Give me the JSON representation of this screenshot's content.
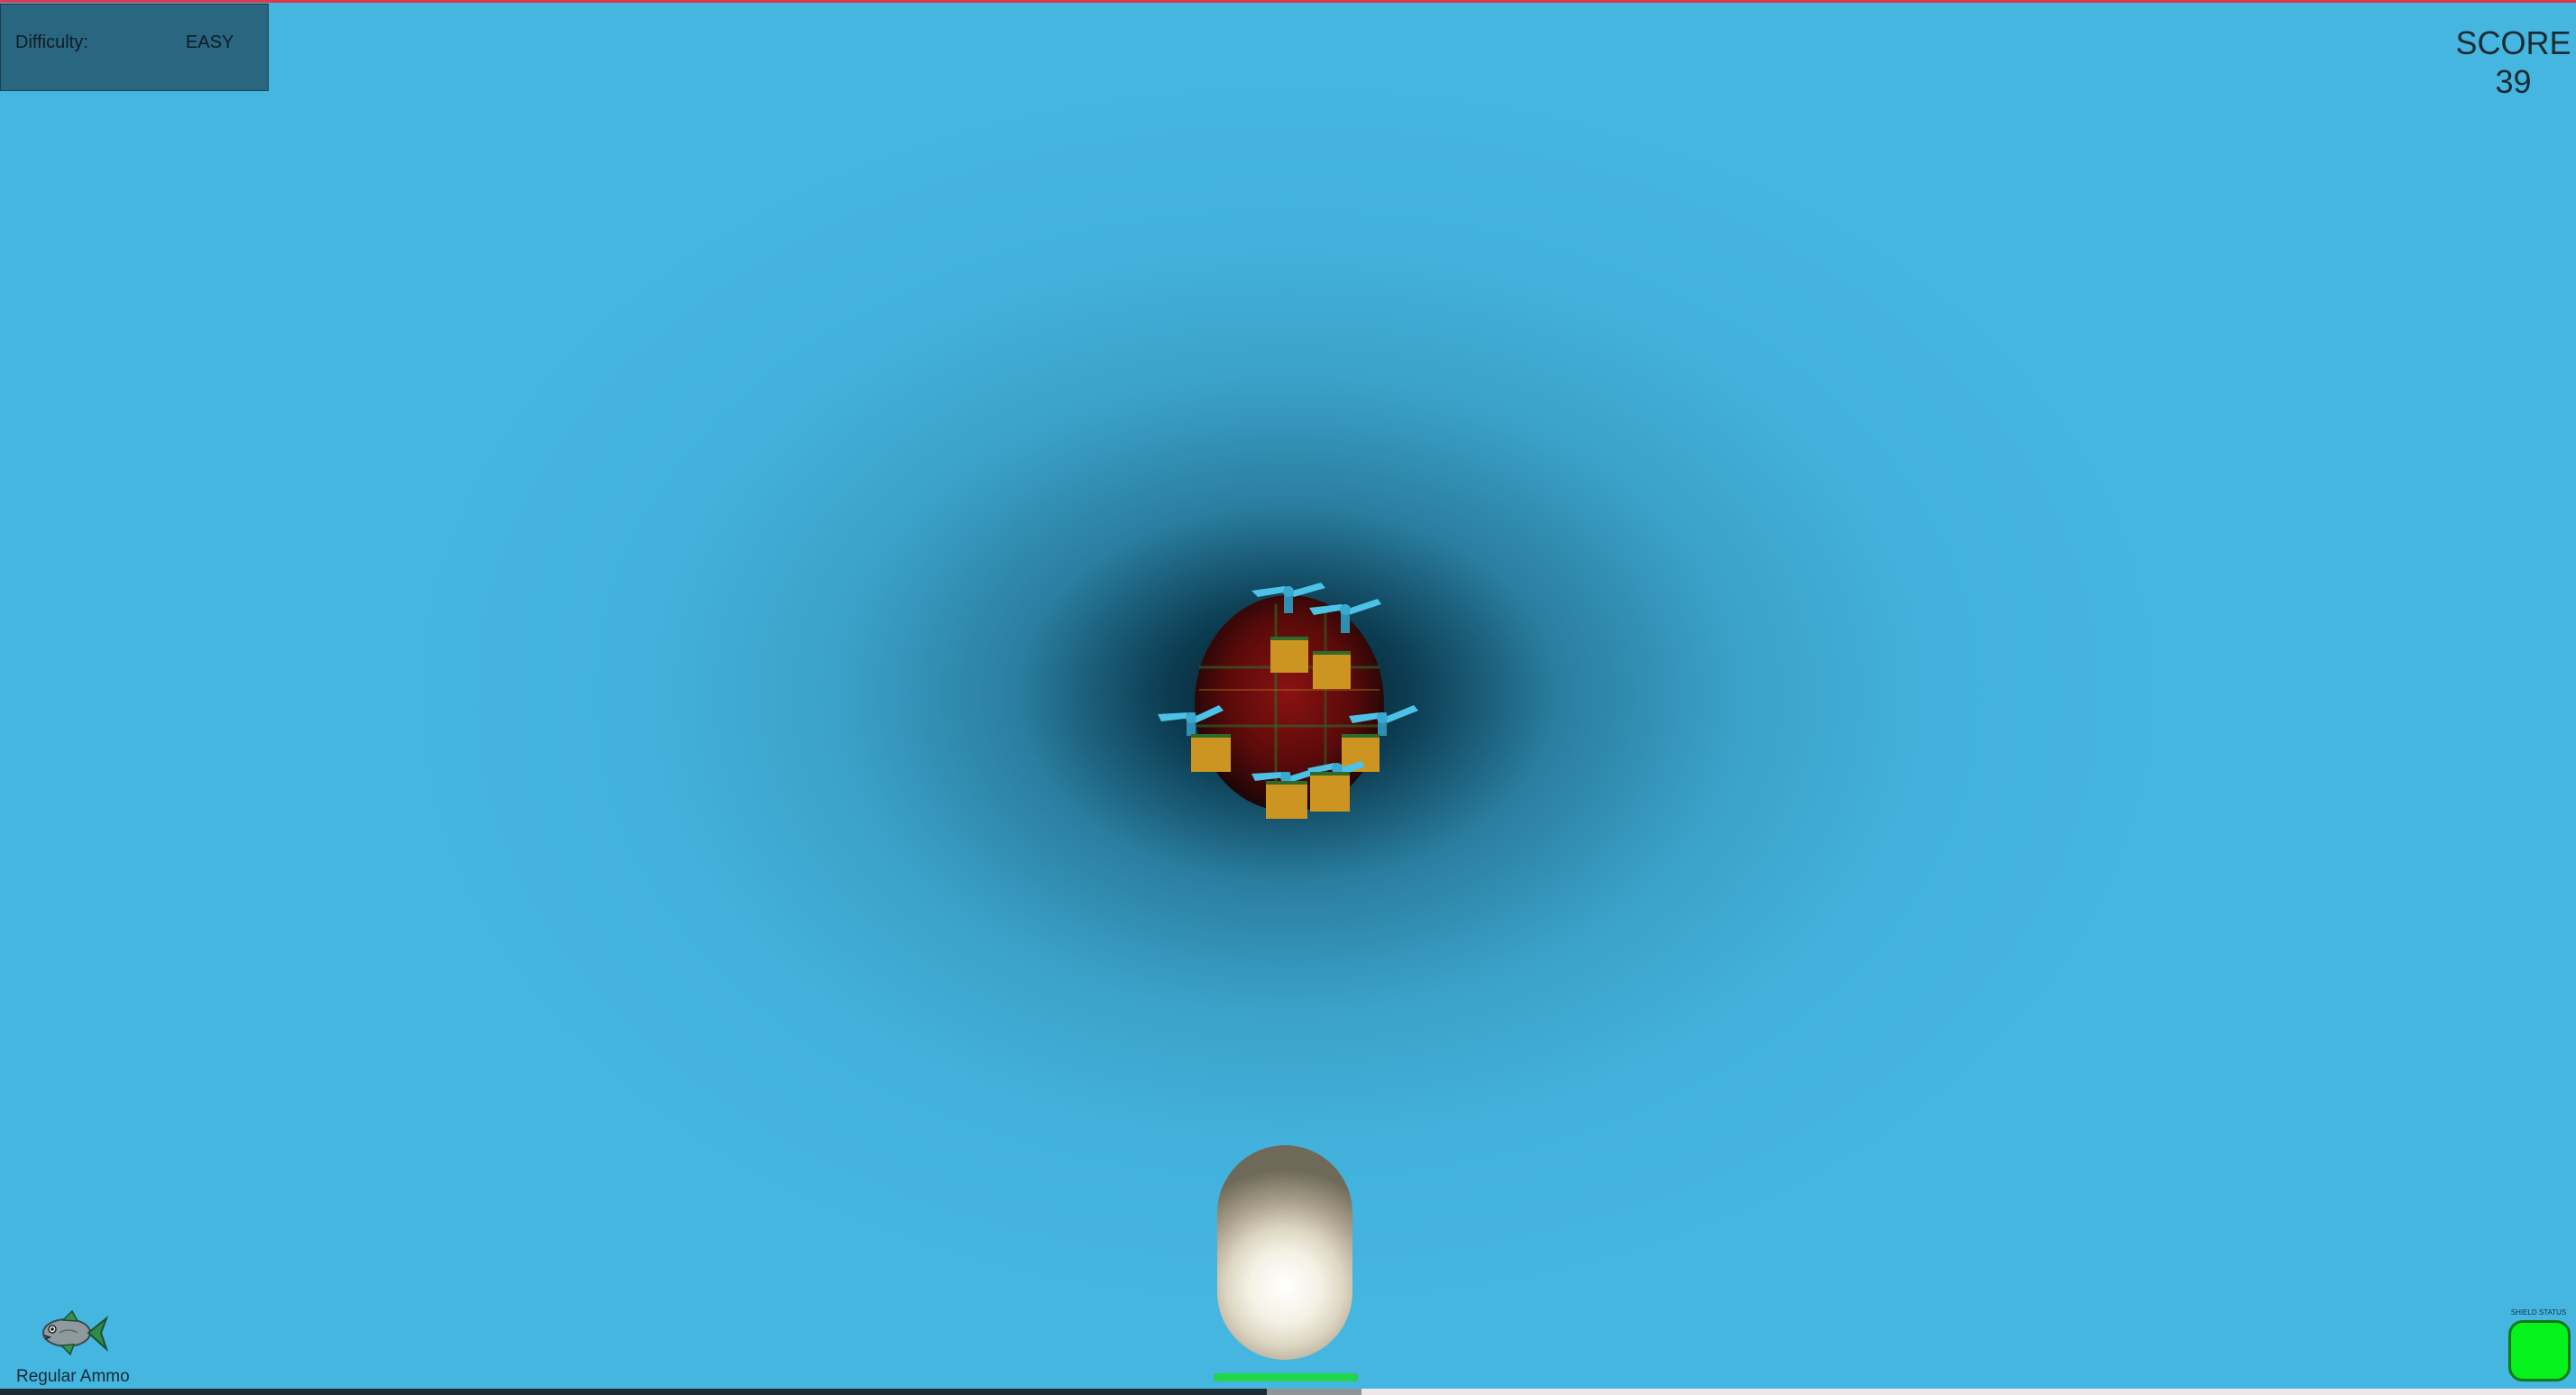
{
  "hud": {
    "difficulty_label": "Difficulty:",
    "difficulty_value": "EASY",
    "score_label": "SCORE",
    "score_value": "39",
    "ammo_label": "Regular Ammo",
    "ammo_icon": "fish-icon",
    "shield_label": "SHIELD STATUS",
    "shield_color": "#06f21c",
    "health_fraction": 1.0,
    "health_color": "#22d64a"
  },
  "scene": {
    "background_color": "#45b6e0",
    "enemy_boss_color": "#7a0e0e",
    "crate_color": "#cc9420",
    "propeller_color": "#4cc3e6",
    "player_ship_color": "#f4f1e4"
  }
}
